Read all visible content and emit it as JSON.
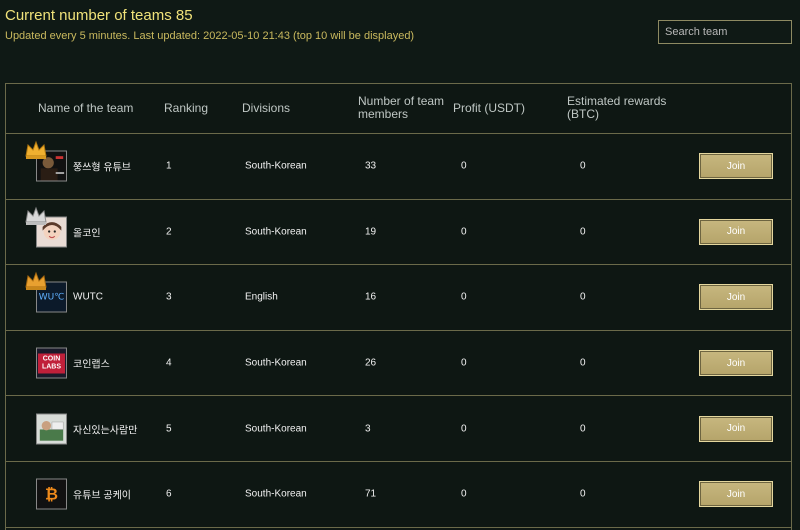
{
  "header": {
    "title": "Current number of teams 85",
    "subtitle": "Updated every 5 minutes. Last updated: 2022-05-10 21:43 (top 10 will be displayed)"
  },
  "search": {
    "placeholder": "Search team",
    "value": ""
  },
  "columns": {
    "name": "Name of the team",
    "ranking": "Ranking",
    "divisions": "Divisions",
    "members": "Number of team members",
    "profit": "Profit (USDT)",
    "rewards": "Estimated rewards (BTC)"
  },
  "colors": {
    "accent": "#f0e27a",
    "button": "#c1b27a",
    "border": "#6b6a4a",
    "background": "#0f1915"
  },
  "rows": [
    {
      "name": "쭝쓰형 유튜브",
      "ranking": "1",
      "division": "South-Korean",
      "members": "33",
      "profit": "0",
      "rewards": "0",
      "join": "Join",
      "crown": "gold-crown-icon",
      "avatar": "team-avatar-1"
    },
    {
      "name": "올코인",
      "ranking": "2",
      "division": "South-Korean",
      "members": "19",
      "profit": "0",
      "rewards": "0",
      "join": "Join",
      "crown": "silver-crown-icon",
      "avatar": "team-avatar-2"
    },
    {
      "name": "WUTC",
      "ranking": "3",
      "division": "English",
      "members": "16",
      "profit": "0",
      "rewards": "0",
      "join": "Join",
      "crown": "bronze-crown-icon",
      "avatar": "team-avatar-3",
      "avatar_text": "WU℃"
    },
    {
      "name": "코인랩스",
      "ranking": "4",
      "division": "South-Korean",
      "members": "26",
      "profit": "0",
      "rewards": "0",
      "join": "Join",
      "avatar": "team-avatar-4",
      "avatar_text": "COIN LABS"
    },
    {
      "name": "자신있는사람만",
      "ranking": "5",
      "division": "South-Korean",
      "members": "3",
      "profit": "0",
      "rewards": "0",
      "join": "Join",
      "avatar": "team-avatar-5"
    },
    {
      "name": "유튜브 공케이",
      "ranking": "6",
      "division": "South-Korean",
      "members": "71",
      "profit": "0",
      "rewards": "0",
      "join": "Join",
      "avatar": "team-avatar-6",
      "avatar_text": "₿"
    }
  ]
}
